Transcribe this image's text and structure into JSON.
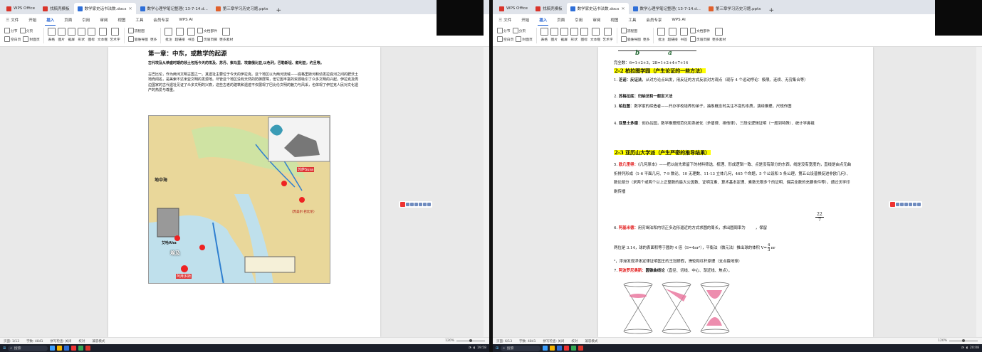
{
  "left": {
    "tabs": [
      {
        "label": "WPS Office",
        "color": "#d9342b",
        "active": false
      },
      {
        "label": "找稿壳模板",
        "color": "#d9342b",
        "active": false
      },
      {
        "label": "数学家史话书法数.docx",
        "color": "#2f6fd8",
        "active": true
      },
      {
        "label": "数学心理学笔记整理( 13-7-14.d...",
        "color": "#2f6fd8",
        "active": false
      },
      {
        "label": "第三章学习历史习题.pptx",
        "color": "#e0602c",
        "active": false
      }
    ],
    "menu": [
      "三 文件",
      "开始",
      "插入",
      "页面",
      "引用",
      "审阅",
      "视图",
      "工具",
      "会员专享",
      "WPS AI"
    ],
    "active_menu": "插入",
    "ribbon": {
      "group1": [
        "分节",
        "分页",
        "空白页",
        "封面页"
      ],
      "group2": [
        "表格",
        "图片",
        "截屏",
        "形状",
        "图标",
        "文本框",
        "艺术字"
      ],
      "group3": [
        "流程图",
        "思维导图",
        "更多"
      ],
      "group4": [
        "批注",
        "超链接",
        "书签",
        "文档部件",
        "页眉页脚",
        "更多素材"
      ]
    },
    "doc": {
      "title": "第一章：中东，或数学的起源",
      "para1": "古代埃及从恭盛时期的领土包括今天的埃及、苏丹、索马里、埃塞俄比亚,以色列，巴勒斯坦、叙利亚，约旦等。",
      "para2": "古巴比伦，作为两河文明古国之一。其遗址主要位于今天的伊拉克。这个地区以为两河流域——底格里斯河和幼发拉底河之间的肥沃土地而闻名，是美索不达米亚文明的发源地。尽管这个地区没有天然的防御屏障，但它因丰富的资源吸引了众多文明的兴起。伊拉克及周边国家的古代遗址见证了众多文明的兴衰，这些古老的建筑和遗迹不仅展现了巴比伦文明的魅力与风采，也体现了伊拉克人民对文化遗产的热爱与尊重。",
      "map_labels": [
        "地中海",
        "苏萨Susa",
        "（苏美尔·巴比伦）",
        "艾哈Aha",
        "埃及",
        "阿拜多斯"
      ]
    },
    "status": {
      "page": "页面: 1/13",
      "words": "字数: 4841",
      "spell": "拼写检查: 关闭",
      "font": "校对",
      "mode": "兼容模式",
      "zoom": "120%"
    },
    "taskbar": {
      "search": "搜索",
      "time": "19:58"
    }
  },
  "right": {
    "tabs": [
      {
        "label": "WPS Office",
        "color": "#d9342b",
        "active": false
      },
      {
        "label": "找稿壳模板",
        "color": "#d9342b",
        "active": false
      },
      {
        "label": "数学家史话书法数.docx",
        "color": "#2f6fd8",
        "active": true
      },
      {
        "label": "数学心理学笔记整理( 13-7-14.d...",
        "color": "#2f6fd8",
        "active": false
      },
      {
        "label": "第三章学习历史习题.pptx",
        "color": "#e0602c",
        "active": false
      }
    ],
    "menu": [
      "三 文件",
      "开始",
      "插入",
      "页面",
      "引用",
      "审阅",
      "视图",
      "工具",
      "会员专享",
      "WPS AI"
    ],
    "active_menu": "插入",
    "ribbon": {
      "group1": [
        "分节",
        "分页",
        "空白页",
        "封面页"
      ],
      "group2": [
        "表格",
        "图片",
        "截屏",
        "形状",
        "图标",
        "文本框",
        "艺术字"
      ],
      "group3": [
        "流程图",
        "思维导图",
        "更多"
      ],
      "group4": [
        "批注",
        "超链接",
        "书签",
        "文档部件",
        "页眉页脚",
        "更多素材"
      ]
    },
    "doc": {
      "ab": [
        "b",
        "a"
      ],
      "perfect": "完全数：6=1+2+3，28=1+2+4+7+14",
      "sec22": "2-2 柏拉图学园（产生论证的一些方法）",
      "i1_num": "1.",
      "i1_name": "芝诺：反证法",
      "i1_text": "，从对方论点出发，用反证的方式反驳对方观点（现存 4 个运动悖论：极限、连续、无穷集合等）",
      "i2_num": "2.",
      "i2_name": "苏格拉底：归纳法和一般定义法",
      "i3_num": "3.",
      "i3_name": "柏拉图",
      "i3_text": "：数学家的缔造者——开办学校培养的弟子，抽象概念时关注不变的本质，演绎推理，尺规作图",
      "i4_num": "4.",
      "i4_name": "亚里士多德",
      "i4_text": "：创办吕园，数学推理规范化和系统化（矛盾律、排他律），三段论逻辑证明（一般到特殊）、统计学鼻祖",
      "sec23": "2-3 亚历山大学派（产生严密的推导结果）",
      "i5_num": "5.",
      "i5_name": "欧几里得：",
      "i5_text": "《几何原本》——把以前先辈留下的材料筛选、梳理、形成逻辑一致、点是没有部分的东西，线是没有宽度的，直线是由点无曲折排列形成（1-6 平面几何、7-9 数论、10 无理数、11-13 立体几何，465 个命题，5 个公设和 5 条公理，第五公设普换促进非欧几何）、数论部分（求两个或两个以上正整数的最大公因数、证明互素、算术基本定理、素数无限多个的证明、偶完全数的充要条件等），通过沃学印刷传播",
      "frac_num": "22",
      "frac_den": "7",
      "i6_num": "6.",
      "i6_name": "阿基米德：",
      "i6_text": "用穷竭法和内切正多边形逼近的方式求圆的周长，求出圆周率为",
      "i6_tail": "，保留",
      "i6_line2": "两位是 3.14，球的表面积等于圆的 4 倍（S=4πr²），平衡法（微元法）推出球的体积 V=",
      "vol_num": "4",
      "vol_den": "3",
      "vol_tail": "πr",
      "i6_line3": "³，浮澡发现浮体定律证明国王的王冠掺假，滑轮和杠杆原理（支点撬地球）",
      "i7_num": "7.",
      "i7_name": "阿波罗尼奥斯：",
      "i7_bold": "圆锥曲线论",
      "i7_text": "（直径、切线、中心、渐近线、焦点），"
    },
    "status": {
      "page": "页面: 6/13",
      "words": "字数: 4841",
      "spell": "拼写检查: 关闭",
      "font": "校对",
      "mode": "兼容模式",
      "zoom": "120%"
    },
    "taskbar": {
      "search": "搜索",
      "time": "20:08"
    }
  },
  "colors": {
    "accent": "#1f5fd1",
    "highlight": "#ffff00",
    "red_text": "#e21b1b",
    "taskbar": "#1b1f2a"
  }
}
